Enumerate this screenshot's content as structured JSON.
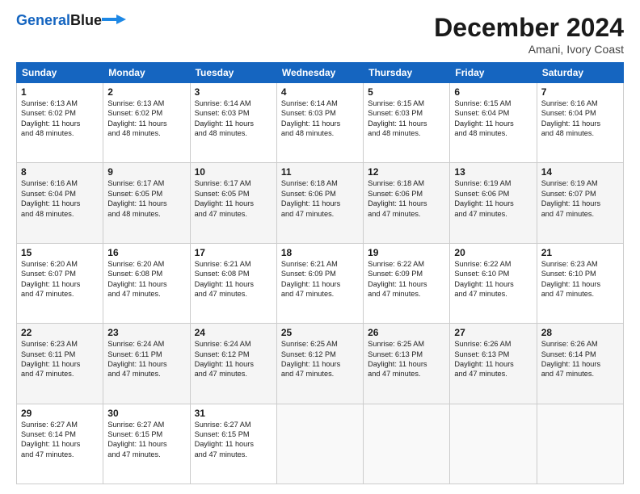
{
  "logo": {
    "line1": "General",
    "line2": "Blue"
  },
  "header": {
    "month": "December 2024",
    "location": "Amani, Ivory Coast"
  },
  "weekdays": [
    "Sunday",
    "Monday",
    "Tuesday",
    "Wednesday",
    "Thursday",
    "Friday",
    "Saturday"
  ],
  "weeks": [
    [
      {
        "day": "1",
        "info": "Sunrise: 6:13 AM\nSunset: 6:02 PM\nDaylight: 11 hours\nand 48 minutes."
      },
      {
        "day": "2",
        "info": "Sunrise: 6:13 AM\nSunset: 6:02 PM\nDaylight: 11 hours\nand 48 minutes."
      },
      {
        "day": "3",
        "info": "Sunrise: 6:14 AM\nSunset: 6:03 PM\nDaylight: 11 hours\nand 48 minutes."
      },
      {
        "day": "4",
        "info": "Sunrise: 6:14 AM\nSunset: 6:03 PM\nDaylight: 11 hours\nand 48 minutes."
      },
      {
        "day": "5",
        "info": "Sunrise: 6:15 AM\nSunset: 6:03 PM\nDaylight: 11 hours\nand 48 minutes."
      },
      {
        "day": "6",
        "info": "Sunrise: 6:15 AM\nSunset: 6:04 PM\nDaylight: 11 hours\nand 48 minutes."
      },
      {
        "day": "7",
        "info": "Sunrise: 6:16 AM\nSunset: 6:04 PM\nDaylight: 11 hours\nand 48 minutes."
      }
    ],
    [
      {
        "day": "8",
        "info": "Sunrise: 6:16 AM\nSunset: 6:04 PM\nDaylight: 11 hours\nand 48 minutes."
      },
      {
        "day": "9",
        "info": "Sunrise: 6:17 AM\nSunset: 6:05 PM\nDaylight: 11 hours\nand 48 minutes."
      },
      {
        "day": "10",
        "info": "Sunrise: 6:17 AM\nSunset: 6:05 PM\nDaylight: 11 hours\nand 47 minutes."
      },
      {
        "day": "11",
        "info": "Sunrise: 6:18 AM\nSunset: 6:06 PM\nDaylight: 11 hours\nand 47 minutes."
      },
      {
        "day": "12",
        "info": "Sunrise: 6:18 AM\nSunset: 6:06 PM\nDaylight: 11 hours\nand 47 minutes."
      },
      {
        "day": "13",
        "info": "Sunrise: 6:19 AM\nSunset: 6:06 PM\nDaylight: 11 hours\nand 47 minutes."
      },
      {
        "day": "14",
        "info": "Sunrise: 6:19 AM\nSunset: 6:07 PM\nDaylight: 11 hours\nand 47 minutes."
      }
    ],
    [
      {
        "day": "15",
        "info": "Sunrise: 6:20 AM\nSunset: 6:07 PM\nDaylight: 11 hours\nand 47 minutes."
      },
      {
        "day": "16",
        "info": "Sunrise: 6:20 AM\nSunset: 6:08 PM\nDaylight: 11 hours\nand 47 minutes."
      },
      {
        "day": "17",
        "info": "Sunrise: 6:21 AM\nSunset: 6:08 PM\nDaylight: 11 hours\nand 47 minutes."
      },
      {
        "day": "18",
        "info": "Sunrise: 6:21 AM\nSunset: 6:09 PM\nDaylight: 11 hours\nand 47 minutes."
      },
      {
        "day": "19",
        "info": "Sunrise: 6:22 AM\nSunset: 6:09 PM\nDaylight: 11 hours\nand 47 minutes."
      },
      {
        "day": "20",
        "info": "Sunrise: 6:22 AM\nSunset: 6:10 PM\nDaylight: 11 hours\nand 47 minutes."
      },
      {
        "day": "21",
        "info": "Sunrise: 6:23 AM\nSunset: 6:10 PM\nDaylight: 11 hours\nand 47 minutes."
      }
    ],
    [
      {
        "day": "22",
        "info": "Sunrise: 6:23 AM\nSunset: 6:11 PM\nDaylight: 11 hours\nand 47 minutes."
      },
      {
        "day": "23",
        "info": "Sunrise: 6:24 AM\nSunset: 6:11 PM\nDaylight: 11 hours\nand 47 minutes."
      },
      {
        "day": "24",
        "info": "Sunrise: 6:24 AM\nSunset: 6:12 PM\nDaylight: 11 hours\nand 47 minutes."
      },
      {
        "day": "25",
        "info": "Sunrise: 6:25 AM\nSunset: 6:12 PM\nDaylight: 11 hours\nand 47 minutes."
      },
      {
        "day": "26",
        "info": "Sunrise: 6:25 AM\nSunset: 6:13 PM\nDaylight: 11 hours\nand 47 minutes."
      },
      {
        "day": "27",
        "info": "Sunrise: 6:26 AM\nSunset: 6:13 PM\nDaylight: 11 hours\nand 47 minutes."
      },
      {
        "day": "28",
        "info": "Sunrise: 6:26 AM\nSunset: 6:14 PM\nDaylight: 11 hours\nand 47 minutes."
      }
    ],
    [
      {
        "day": "29",
        "info": "Sunrise: 6:27 AM\nSunset: 6:14 PM\nDaylight: 11 hours\nand 47 minutes."
      },
      {
        "day": "30",
        "info": "Sunrise: 6:27 AM\nSunset: 6:15 PM\nDaylight: 11 hours\nand 47 minutes."
      },
      {
        "day": "31",
        "info": "Sunrise: 6:27 AM\nSunset: 6:15 PM\nDaylight: 11 hours\nand 47 minutes."
      },
      {
        "day": "",
        "info": ""
      },
      {
        "day": "",
        "info": ""
      },
      {
        "day": "",
        "info": ""
      },
      {
        "day": "",
        "info": ""
      }
    ]
  ]
}
